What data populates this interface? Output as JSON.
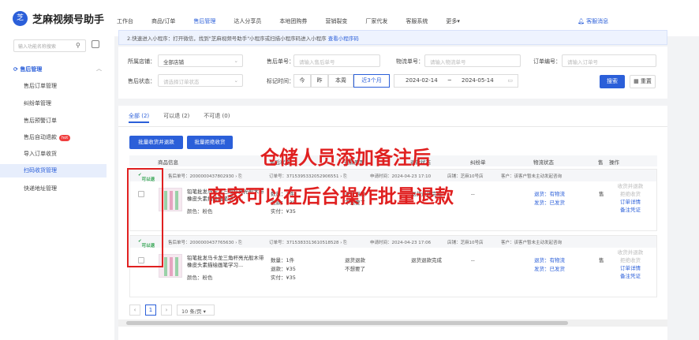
{
  "app": {
    "logo_char": "芝",
    "title": "芝麻视频号助手"
  },
  "nav": [
    "工作台",
    "商品/订单",
    "售后管理",
    "达人分享员",
    "本地团购券",
    "营销裂变",
    "厂家代发",
    "客服系统",
    "更多▾"
  ],
  "nav_active": 2,
  "message_link": "客服消息",
  "sidebar": {
    "search_placeholder": "输入功能名称搜索",
    "group_label": "售后管理",
    "items": [
      "售后订单管理",
      "纠纷单管理",
      "售后预警订单",
      "售后自动退款",
      "导入订单收货",
      "扫码收货管理",
      "快递地址管理"
    ],
    "hot_badge": "hot",
    "active_index": 5
  },
  "notice": {
    "text": "2.快速进入小程序：打开微信，找到\"芝麻视频号助手\"小程序或扫描小程序码进入小程序",
    "link": "查看小程序码"
  },
  "filters": {
    "shop_label": "所属店铺：",
    "shop_value": "全部店铺",
    "after_no_label": "售后单号：",
    "after_no_placeholder": "请输入售后单号",
    "logistics_label": "物流单号：",
    "logistics_placeholder": "请输入物流单号",
    "order_label": "订单编号：",
    "order_placeholder": "请输入订单号",
    "status_label": "售后状态：",
    "status_placeholder": "请选择订单状态",
    "mark_time_label": "标记时间：",
    "date_buttons": [
      "今",
      "昨",
      "本周",
      "近3个月"
    ],
    "date_active": 3,
    "date_from": "2024-02-14",
    "date_sep": "~",
    "date_to": "2024-05-14",
    "search_btn": "搜索",
    "reset_btn": "重置"
  },
  "tabs": [
    "全部 (2)",
    "可以退 (2)",
    "不可退 (0)"
  ],
  "tab_active": 0,
  "bulk": {
    "refund_btn": "批量收货并退款",
    "receive_btn": "批量拒绝收货"
  },
  "columns": [
    "商品信息",
    "售后状态",
    "退款原因",
    "退款状态",
    "纠纷单",
    "物流状态",
    "售",
    "操作"
  ],
  "rows": [
    {
      "tag": "可以退",
      "after_no": "售后单号：2000000437802930 › ⎘",
      "order_no": "订单号：3715395332052906551 › ⎘",
      "apply_time": "申请时间：2024-04-23 17:10",
      "shop": "店铺：芝麻10号店",
      "buyer": "客户：该客户暂未主动发起咨询",
      "product": "铅笔批发马卡龙三角杆亮光般木带橡皮头素描绘画笔学习...",
      "color": "颜色：粉色",
      "qty": "数量：1件",
      "refund": "退款：¥35",
      "paid": "实付：¥35",
      "status": "退货退款",
      "reason": "不想要了",
      "refund_status": "退货退款完成",
      "dispute": "--",
      "logi1": "退货：有物流",
      "logi2": "发货：已发货",
      "ops": [
        "收货并退款",
        "拒绝收货",
        "订单详情",
        "备注凭证"
      ]
    },
    {
      "tag": "可以退",
      "after_no": "售后单号：2000000437765630 › ⎘",
      "order_no": "订单号：3715383313610518528 › ⎘",
      "apply_time": "申请时间：2024-04-23 17:06",
      "shop": "店铺：芝麻10号店",
      "buyer": "客户：该客户暂未主动发起咨询",
      "product": "铅笔批发马卡龙三角杆亮光般木带橡皮头素描绘画笔学习...",
      "color": "颜色：粉色",
      "qty": "数量：1件",
      "refund": "退款：¥35",
      "paid": "实付：¥35",
      "status": "退货退款",
      "reason": "不想要了",
      "refund_status": "退货退款完成",
      "dispute": "--",
      "logi1": "退货：有物流",
      "logi2": "发货：已发货",
      "ops": [
        "收货并退款",
        "拒绝收货",
        "订单详情",
        "备注凭证"
      ]
    }
  ],
  "pagination": {
    "prev": "‹",
    "page": "1",
    "next": "›",
    "size": "10 条/页 ▾"
  },
  "annotation": {
    "line1": "仓储人员添加备注后",
    "line2": "商家可以在后台操作批量退款"
  },
  "colors": {
    "primary": "#2b5fd9",
    "annotation": "#e02020",
    "ok": "#2aa14a"
  }
}
